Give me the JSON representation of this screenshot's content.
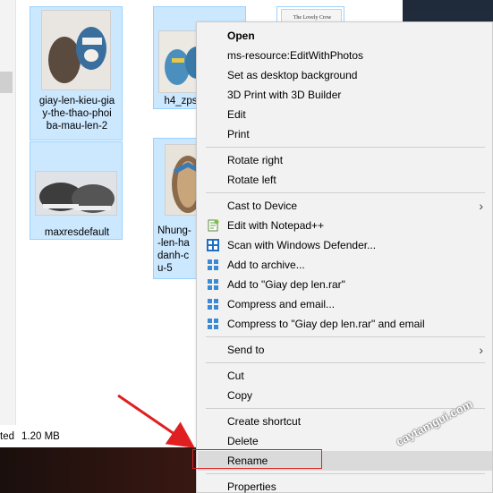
{
  "files": [
    {
      "label": "giay-len-kieu-gia\ny-the-thao-phoi\nba-mau-len-2"
    },
    {
      "label": "h4_zps"
    },
    {
      "label": ""
    },
    {
      "label": "maxresdefault"
    },
    {
      "label": "Nhung-\n-len-ha\ndanh-c\nu-5"
    }
  ],
  "status": {
    "left": "ted",
    "size": "1.20 MB"
  },
  "menu": {
    "items": [
      {
        "label": "Open",
        "bold": true
      },
      {
        "label": "ms-resource:EditWithPhotos"
      },
      {
        "label": "Set as desktop background"
      },
      {
        "label": "3D Print with 3D Builder"
      },
      {
        "label": "Edit"
      },
      {
        "label": "Print"
      },
      {
        "label": "Rotate right"
      },
      {
        "label": "Rotate left"
      },
      {
        "label": "Cast to Device",
        "submenu": true
      },
      {
        "label": "Edit with Notepad++",
        "icon": "notepad-plus-icon"
      },
      {
        "label": "Scan with Windows Defender...",
        "icon": "windows-defender-icon"
      },
      {
        "label": "Add to archive...",
        "icon": "winrar-icon"
      },
      {
        "label": "Add to \"Giay dep len.rar\"",
        "icon": "winrar-icon"
      },
      {
        "label": "Compress and email...",
        "icon": "winrar-icon"
      },
      {
        "label": "Compress to \"Giay dep len.rar\" and email",
        "icon": "winrar-icon"
      },
      {
        "label": "Send to",
        "submenu": true
      },
      {
        "label": "Cut"
      },
      {
        "label": "Copy"
      },
      {
        "label": "Create shortcut"
      },
      {
        "label": "Delete"
      },
      {
        "label": "Rename",
        "highlighted": true
      },
      {
        "label": "Properties"
      }
    ],
    "chevron": "›"
  },
  "watermark": "caytamgui.com",
  "colors": {
    "selection": "#cce8ff",
    "highlight": "#dadada",
    "annotation": "#dd2222"
  }
}
